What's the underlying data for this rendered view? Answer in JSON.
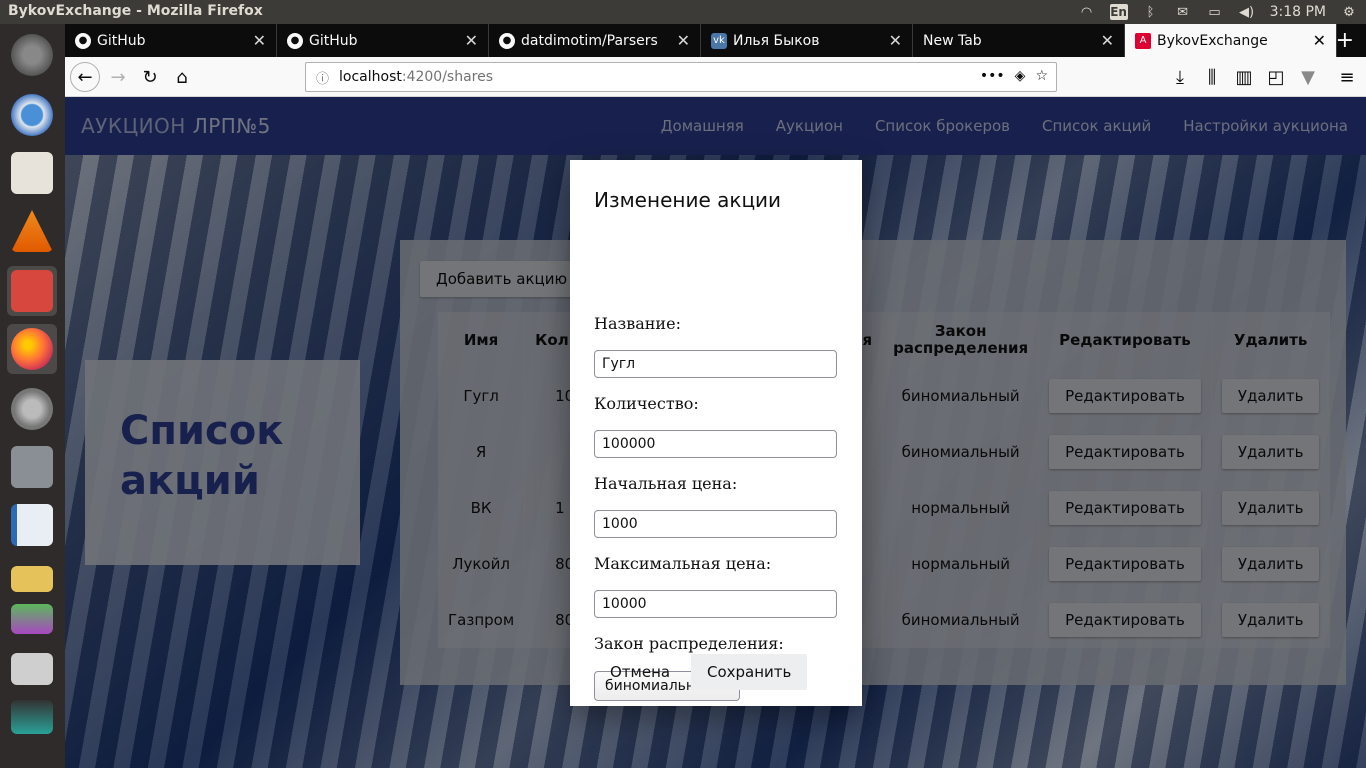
{
  "os_panel": {
    "title": "BykovExchange - Mozilla Firefox",
    "language": "En",
    "time": "3:18 PM"
  },
  "browser": {
    "tabs": [
      {
        "label": "GitHub",
        "icon": "github-icon"
      },
      {
        "label": "GitHub",
        "icon": "github-icon"
      },
      {
        "label": "datdimotim/Parsers",
        "icon": "github-icon"
      },
      {
        "label": "Илья Быков",
        "icon": "vk-icon"
      },
      {
        "label": "New Tab",
        "icon": ""
      },
      {
        "label": "BykovExchange",
        "icon": "angular-icon",
        "active": true
      }
    ],
    "url_host": "localhost",
    "url_path": ":4200/shares"
  },
  "app": {
    "brand": "АУКЦИОН",
    "brand_suffix": "ЛРП№5",
    "nav": [
      "Домашняя",
      "Аукцион",
      "Список брокеров",
      "Список акций",
      "Настройки аукциона"
    ],
    "page_title_line1": "Список",
    "page_title_line2": "акций",
    "add_button": "Добавить акцию",
    "table": {
      "headers": [
        "Имя",
        "Коли",
        "я",
        "Закон распределения",
        "Редактировать",
        "Удалить"
      ],
      "rows": [
        {
          "name": "Гугл",
          "qty": "10",
          "law": "биномиальный"
        },
        {
          "name": "Я",
          "qty": "",
          "law": "биномиальный"
        },
        {
          "name": "ВК",
          "qty": "1",
          "law": "нормальный"
        },
        {
          "name": "Лукойл",
          "qty": "80",
          "law": "нормальный"
        },
        {
          "name": "Газпром",
          "qty": "80",
          "law": "биномиальный"
        }
      ],
      "edit_label": "Редактировать",
      "delete_label": "Удалить"
    }
  },
  "modal": {
    "title": "Изменение акции",
    "name_label": "Название:",
    "name_value": "Гугл",
    "qty_label": "Количество:",
    "qty_value": "100000",
    "start_price_label": "Начальная цена:",
    "start_price_value": "1000",
    "max_price_label": "Максимальная цена:",
    "max_price_value": "10000",
    "law_label": "Закон распределения:",
    "law_value": "биномиальный",
    "cancel": "Отмена",
    "save": "Сохранить"
  },
  "colors": {
    "app_nav": "#2c3d8f",
    "title": "#2c3d8f"
  }
}
